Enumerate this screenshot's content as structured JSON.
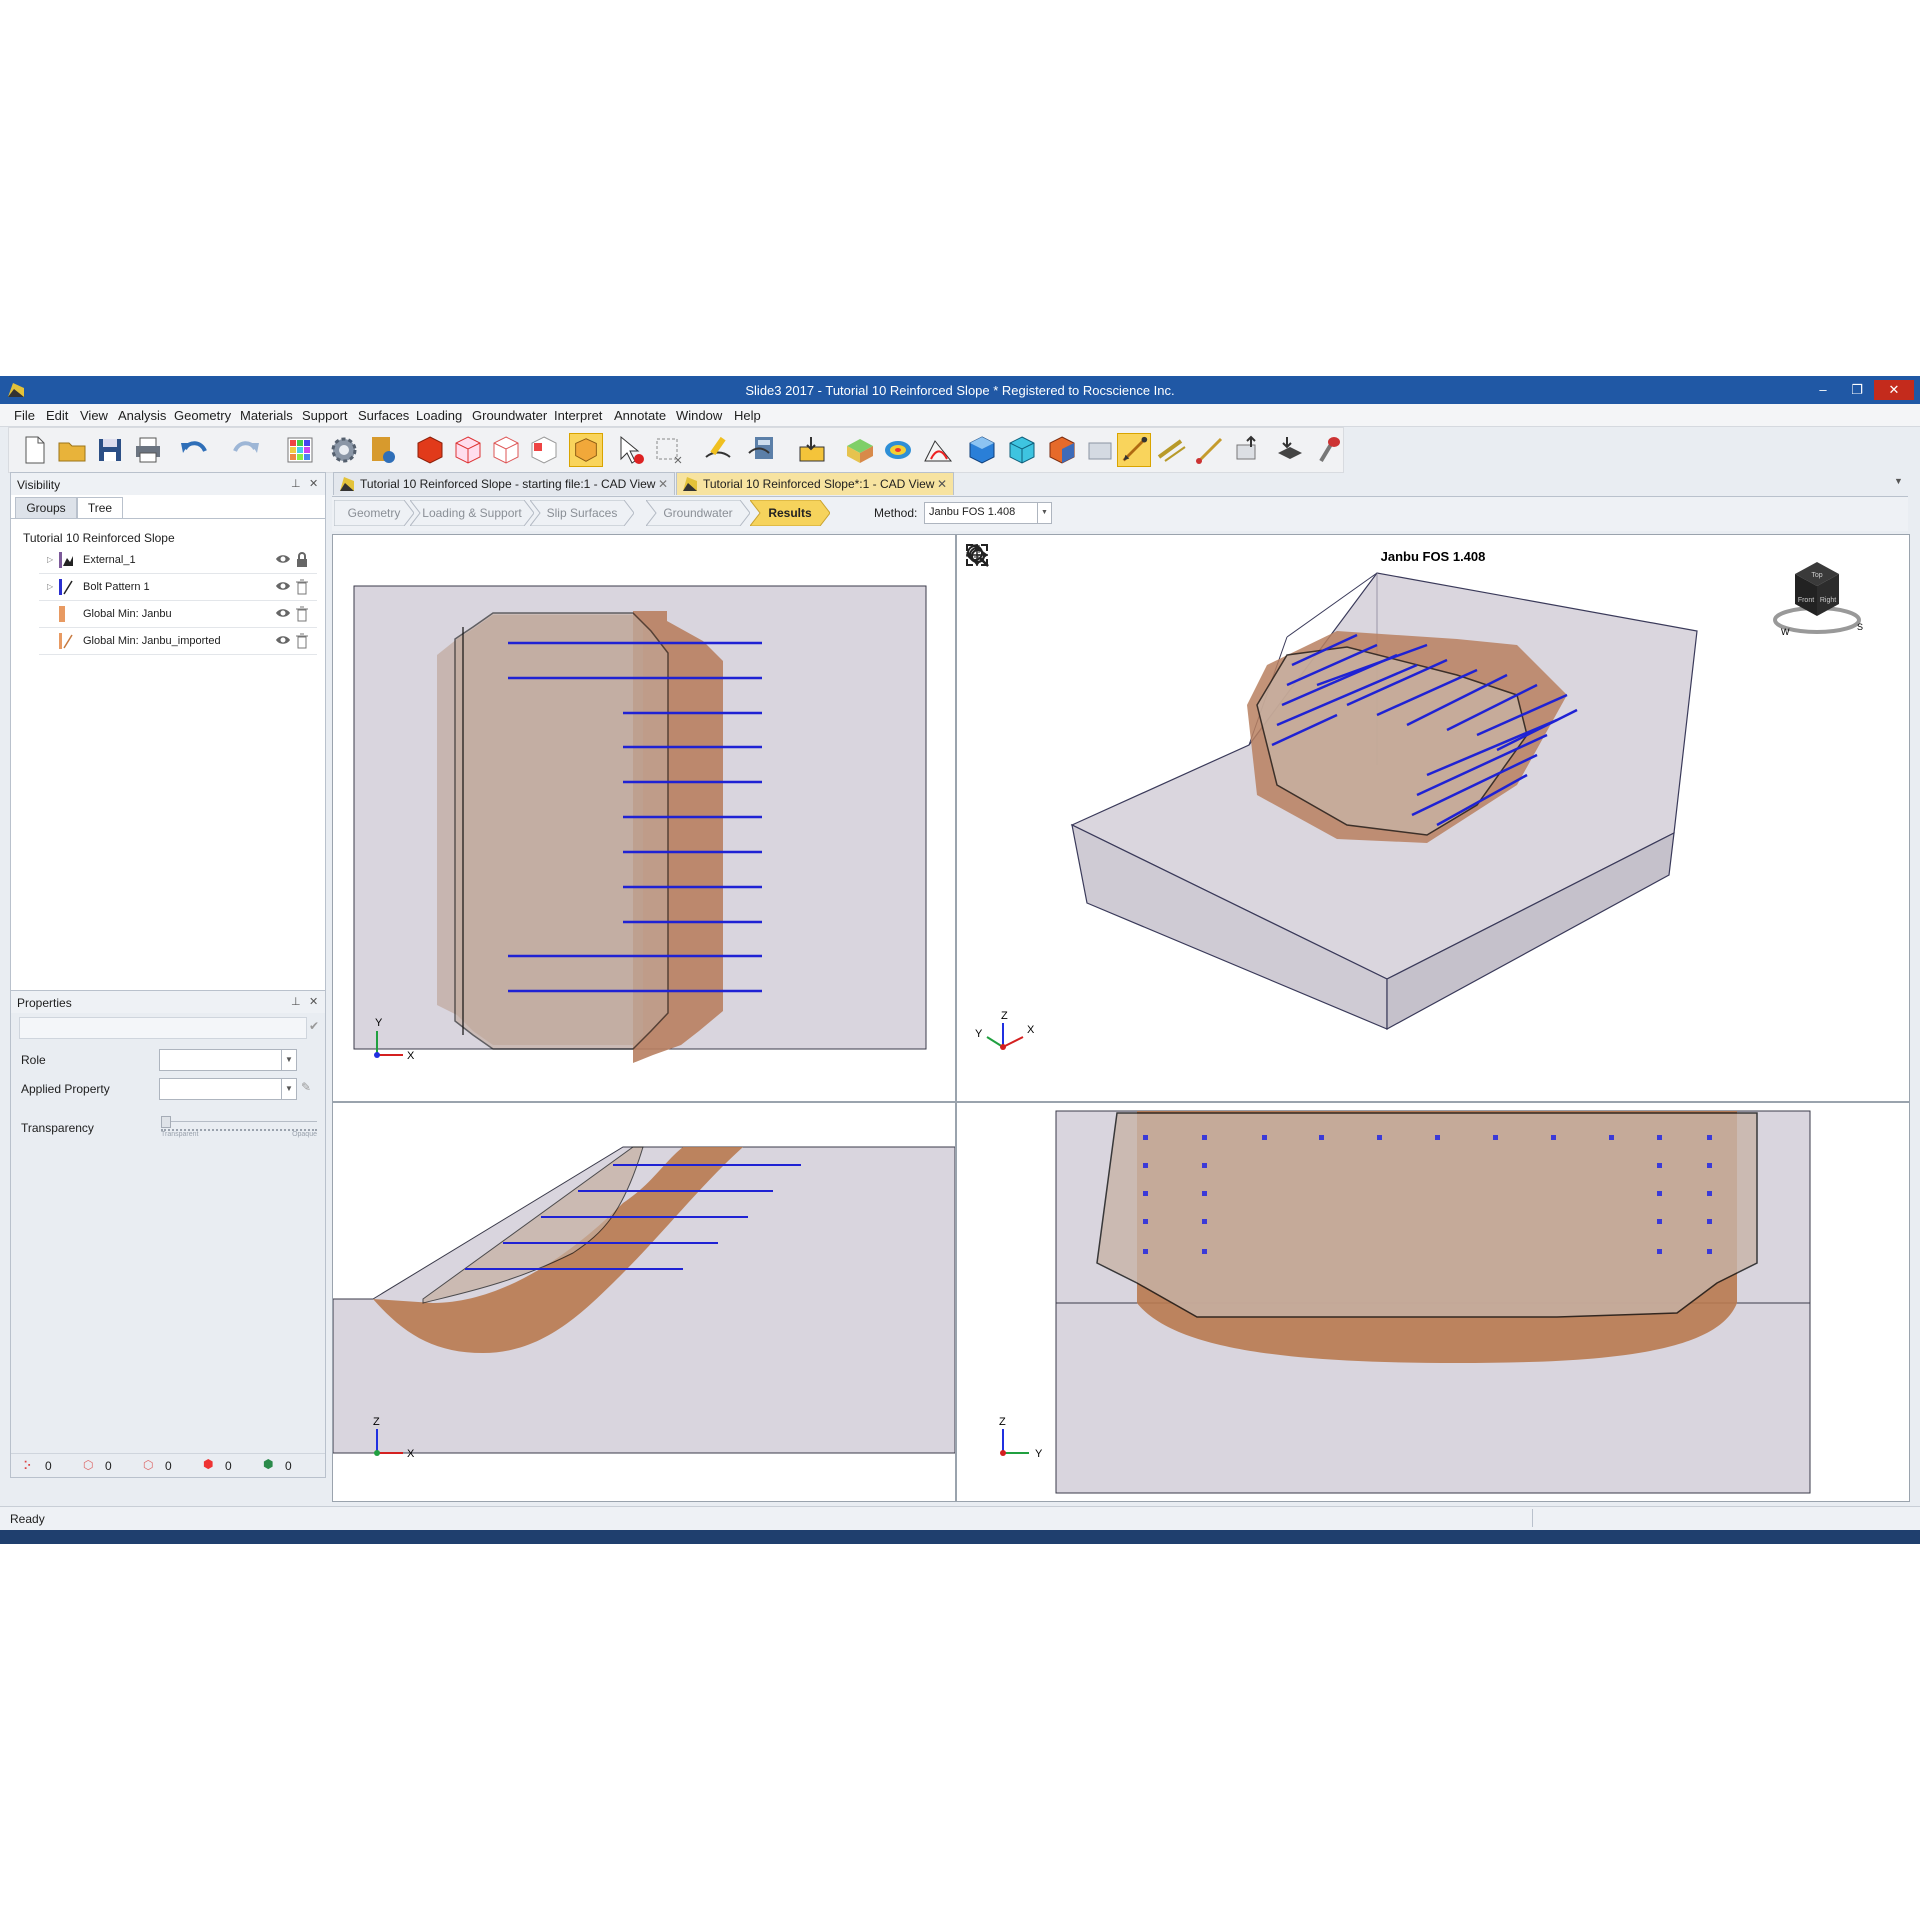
{
  "window": {
    "title": "Slide3 2017 - Tutorial 10 Reinforced Slope *      Registered to Rocscience Inc.",
    "controls": [
      "–",
      "❐",
      "✕"
    ]
  },
  "menu": [
    "File",
    "Edit",
    "View",
    "Analysis",
    "Geometry",
    "Materials",
    "Support",
    "Surfaces",
    "Loading",
    "Groundwater",
    "Interpret",
    "Annotate",
    "Window",
    "Help"
  ],
  "toolbar": {
    "icons": [
      "new-file-icon",
      "open-folder-icon",
      "save-icon",
      "print-icon",
      "undo-icon",
      "redo-icon",
      "color-grid-icon",
      "settings-gear-icon",
      "project-info-icon",
      "solid-red-cube-icon",
      "wireframe-red-cube-icon",
      "wire-cube-icon",
      "outline-cube-icon",
      "highlight-cube-icon",
      "select-pointer-icon",
      "box-select-icon",
      "edit-pen-icon",
      "compute-icon",
      "interpret-icon",
      "surface-icon",
      "contour-icon",
      "section-icon",
      "blue-cube-icon",
      "cyan-cube-icon",
      "orange-cube-icon",
      "show-panel-icon",
      "bolt-support-icon",
      "bolt-pattern-icon",
      "anchor-icon",
      "export-icon",
      "import-icon",
      "terrain-icon",
      "brush-icon"
    ]
  },
  "visibility_panel": {
    "title": "Visibility",
    "tabs": [
      "Groups",
      "Tree"
    ],
    "active_tab": "Tree",
    "root": "Tutorial 10 Reinforced Slope",
    "items": [
      {
        "label": "External_1",
        "locked": true
      },
      {
        "label": "Bolt Pattern 1",
        "locked": false
      },
      {
        "label": "Global Min: Janbu",
        "locked": false
      },
      {
        "label": "Global Min: Janbu_imported",
        "locked": false
      }
    ]
  },
  "properties_panel": {
    "title": "Properties",
    "role_label": "Role",
    "applied_property_label": "Applied Property",
    "transparency_label": "Transparency",
    "slider_min": "Transparent",
    "slider_max": "Opaque"
  },
  "counters": [
    "0",
    "0",
    "0",
    "0",
    "0"
  ],
  "doc_tabs": [
    {
      "label": "Tutorial 10 Reinforced Slope - starting file:1 - CAD View",
      "active": false
    },
    {
      "label": "Tutorial 10 Reinforced Slope*:1 - CAD View",
      "active": true
    }
  ],
  "workflow": [
    "Geometry",
    "Loading & Support",
    "Slip Surfaces",
    "Groundwater",
    "Results"
  ],
  "active_step": "Results",
  "method": {
    "label": "Method:",
    "value": "Janbu FOS    1.408"
  },
  "viewport_3d": {
    "title": "Janbu FOS 1.408",
    "view_cube": {
      "face_top": "Top",
      "face_front": "Front",
      "face_right": "Right",
      "compass_w": "W",
      "compass_s": "S"
    }
  },
  "axes": {
    "top_view": [
      "Y",
      "X"
    ],
    "view_3d": [
      "Z",
      "Y",
      "X"
    ],
    "front_view": [
      "Z",
      "X"
    ],
    "side_view": [
      "Z",
      "Y"
    ]
  },
  "colors": {
    "bolt": "#1f22d4",
    "slip": "#b87a55",
    "block": "#d8d5dd",
    "accent": "#f6d35c"
  },
  "status": "Ready"
}
